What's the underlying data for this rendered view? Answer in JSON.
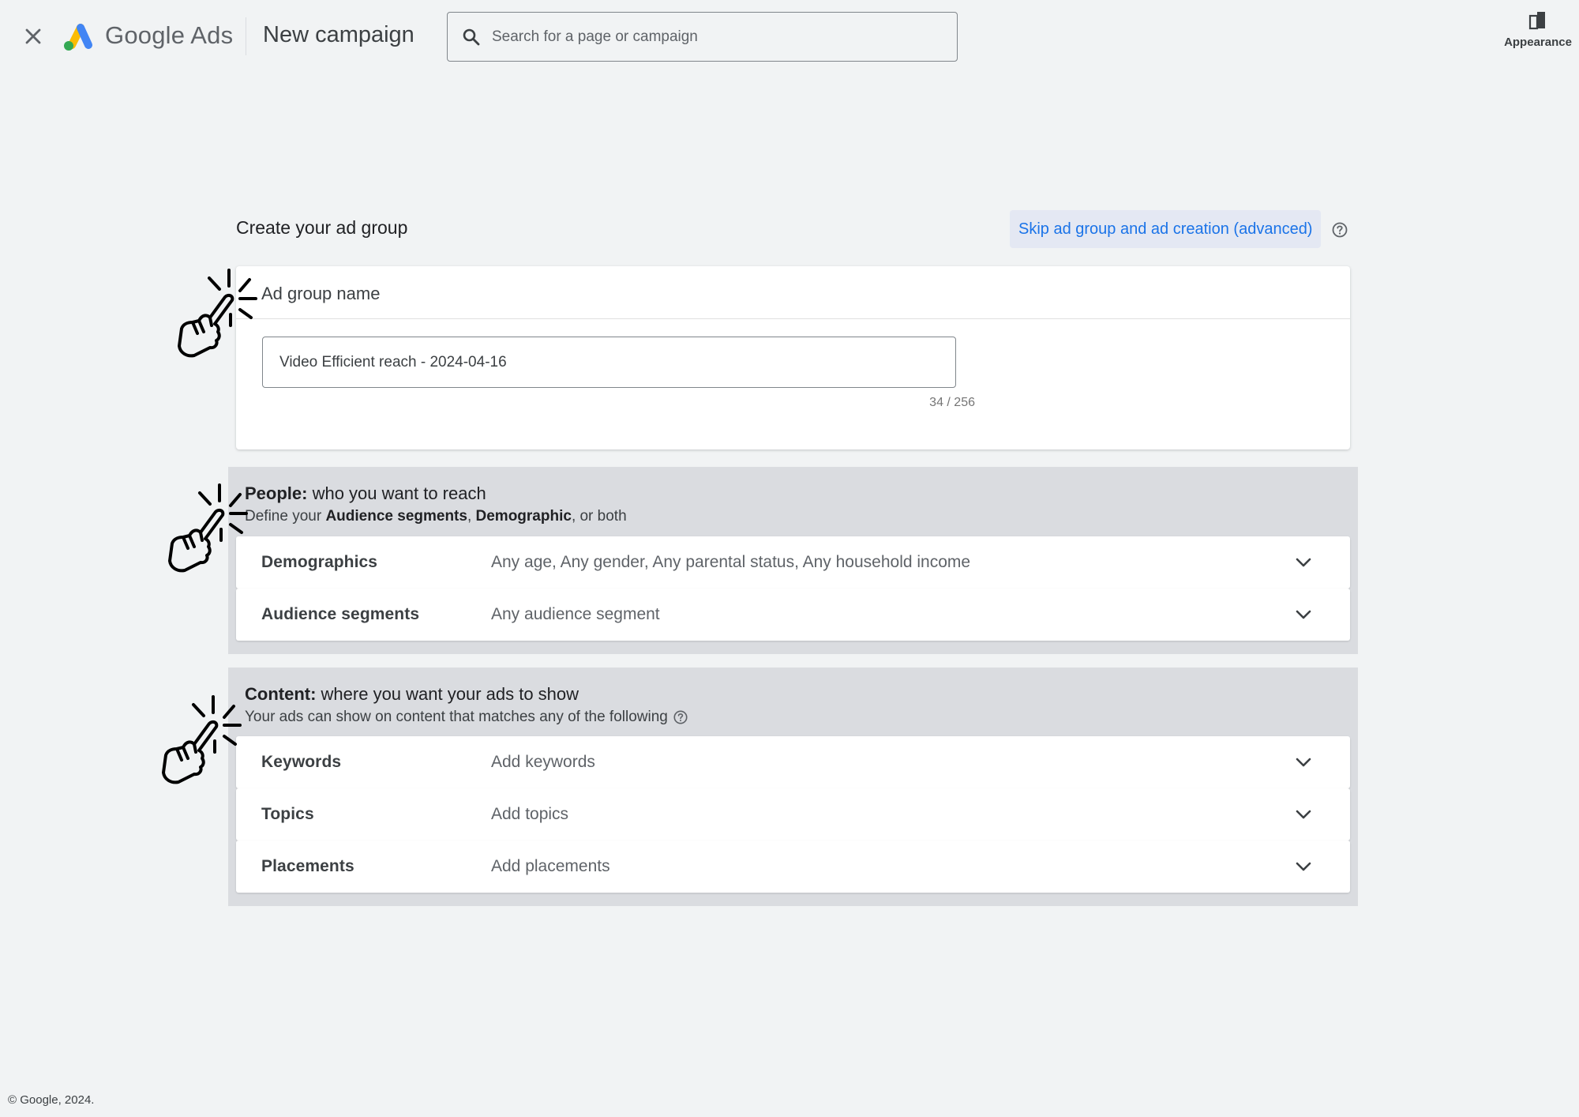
{
  "header": {
    "brand": "Google Ads",
    "page_title": "New campaign",
    "search_placeholder": "Search for a page or campaign",
    "appearance_label": "Appearance"
  },
  "ad_group": {
    "section_title": "Create your ad group",
    "skip_label": "Skip ad group and ad creation (advanced)",
    "name_card_title": "Ad group name",
    "name_value": "Video Efficient reach - 2024-04-16",
    "char_count": "34 / 256"
  },
  "people": {
    "title_bold": "People:",
    "title_rest": " who you want to reach",
    "sub_prefix": "Define your ",
    "sub_bold_1": "Audience segments",
    "sub_sep": ", ",
    "sub_bold_2": "Demographic",
    "sub_suffix": ", or both",
    "rows": [
      {
        "label": "Demographics",
        "value": "Any age, Any gender, Any parental status, Any household income"
      },
      {
        "label": "Audience segments",
        "value": "Any audience segment"
      }
    ]
  },
  "content": {
    "title_bold": "Content:",
    "title_rest": " where you want your ads to show",
    "subtitle": "Your ads can show on content that matches any of the following",
    "rows": [
      {
        "label": "Keywords",
        "value": "Add keywords"
      },
      {
        "label": "Topics",
        "value": "Add topics"
      },
      {
        "label": "Placements",
        "value": "Add placements"
      }
    ]
  },
  "footer": {
    "copyright": "© Google, 2024."
  },
  "colors": {
    "background": "#f1f3f4",
    "panel": "#dadce0",
    "link_blue": "#1a73e8",
    "logo_blue": "#4285f4",
    "logo_yellow": "#fbbc04",
    "logo_green": "#34a853"
  },
  "icons": [
    "close-icon",
    "google-ads-logo-icon",
    "search-icon",
    "appearance-icon",
    "help-icon",
    "chevron-down-icon",
    "click-hand-icon"
  ]
}
